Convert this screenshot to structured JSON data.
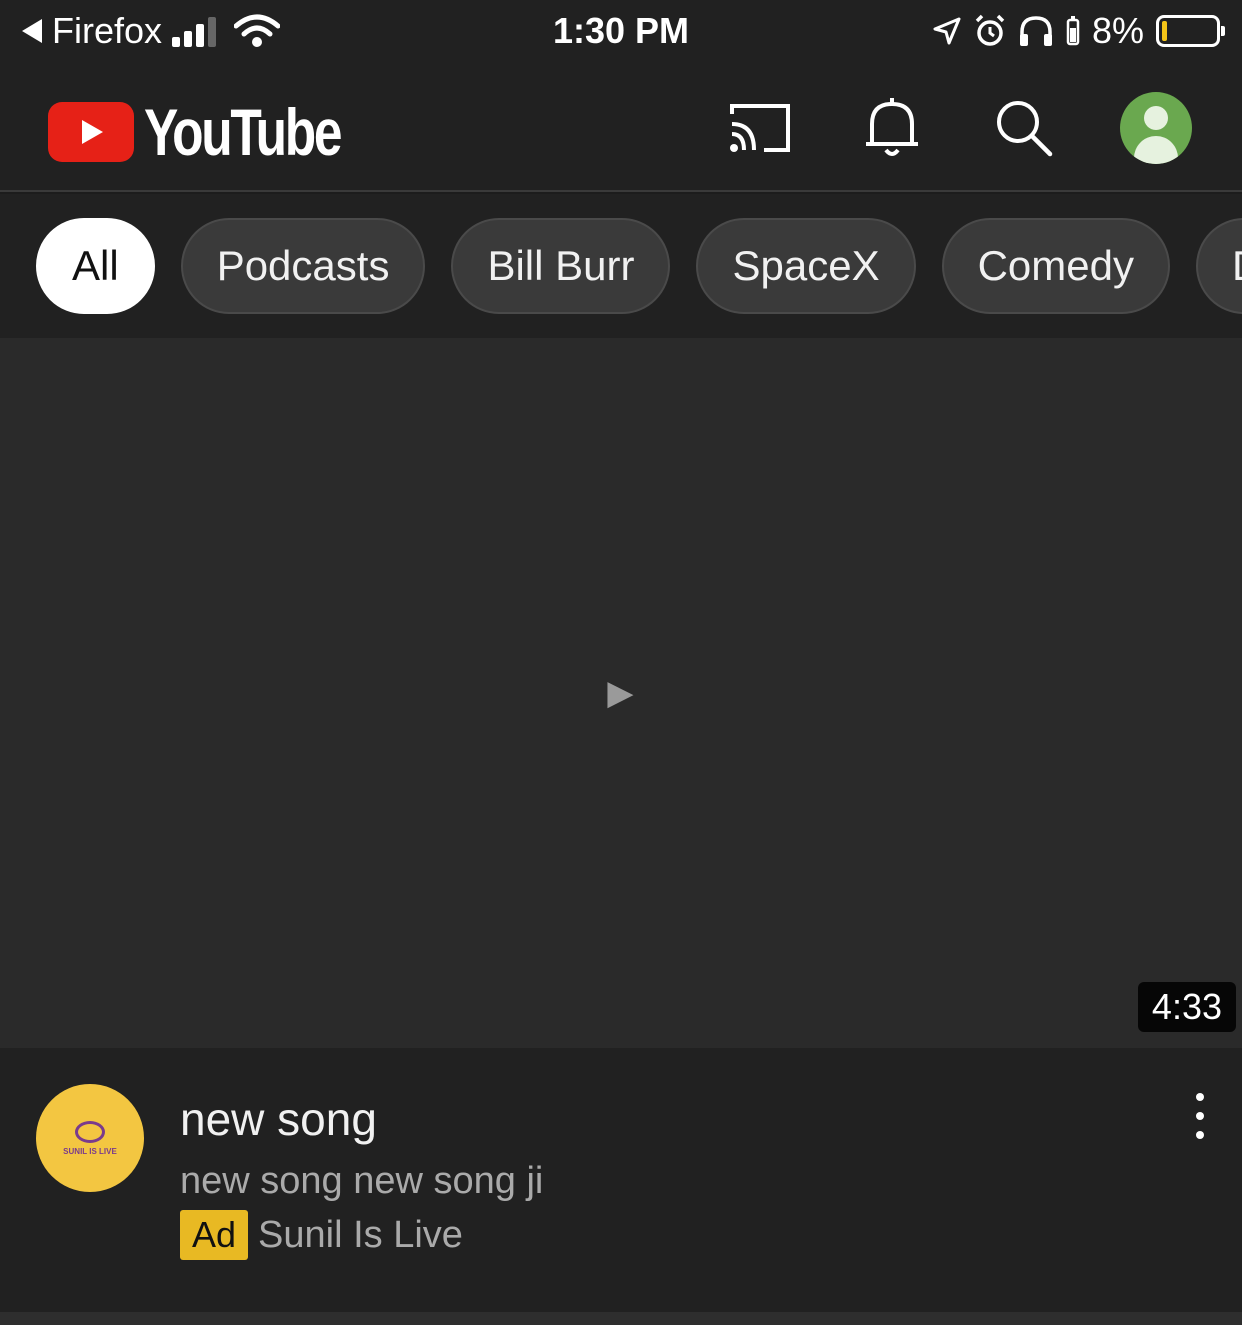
{
  "status_bar": {
    "back_app": "Firefox",
    "time": "1:30 PM",
    "battery_percent": "8%",
    "battery_level": 0.08
  },
  "header": {
    "logo_text": "YouTube",
    "icons": [
      "cast-icon",
      "bell-icon",
      "search-icon",
      "account-icon"
    ]
  },
  "chips": [
    {
      "label": "All",
      "active": true
    },
    {
      "label": "Podcasts",
      "active": false
    },
    {
      "label": "Bill Burr",
      "active": false
    },
    {
      "label": "SpaceX",
      "active": false
    },
    {
      "label": "Comedy",
      "active": false
    },
    {
      "label": "D",
      "active": false
    }
  ],
  "video": {
    "duration": "4:33",
    "title": "new song",
    "description": "new song new song ji",
    "ad_label": "Ad",
    "advertiser": "Sunil Is Live",
    "channel_avatar_text": "SUNIL IS LIVE"
  },
  "colors": {
    "background": "#212121",
    "brand_red": "#e62117",
    "ad_badge": "#e8b923",
    "avatar_green": "#6aa84f"
  }
}
